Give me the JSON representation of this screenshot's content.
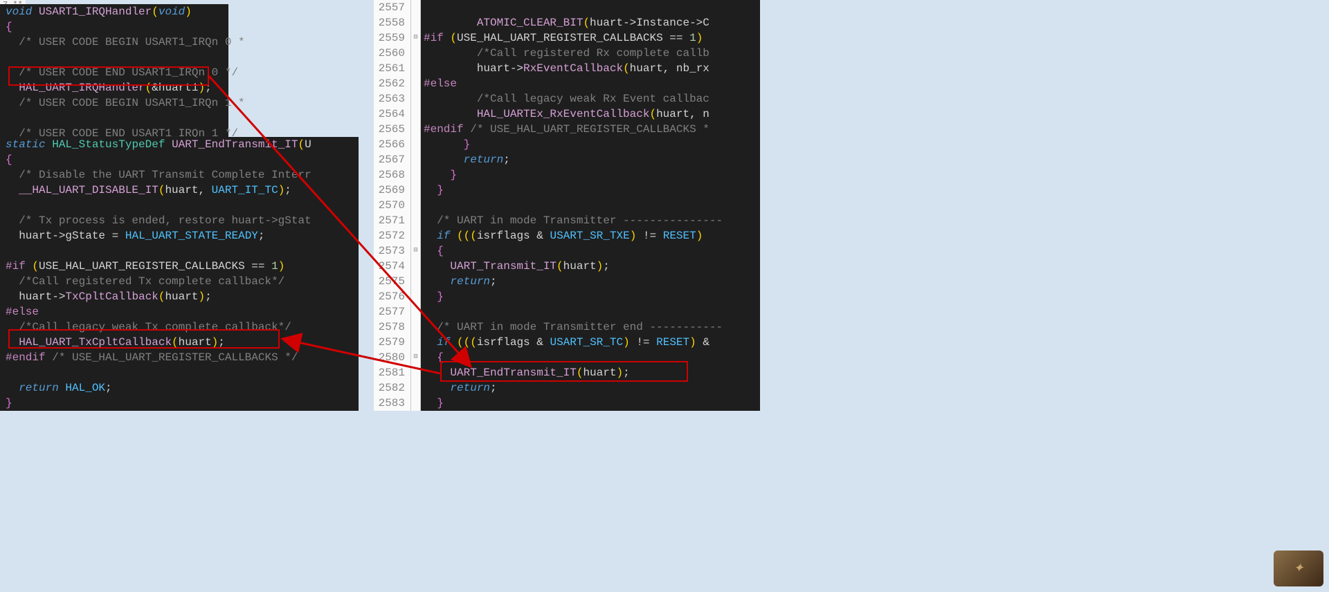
{
  "topleft": "7 **",
  "left_top_lines": [
    {
      "tokens": [
        {
          "c": "kw",
          "t": "void"
        },
        {
          "c": "plain",
          "t": " "
        },
        {
          "c": "fn2",
          "t": "USART1_IRQHandler"
        },
        {
          "c": "paren",
          "t": "("
        },
        {
          "c": "kw",
          "t": "void"
        },
        {
          "c": "paren",
          "t": ")"
        }
      ]
    },
    {
      "tokens": [
        {
          "c": "brace",
          "t": "{"
        }
      ]
    },
    {
      "tokens": [
        {
          "c": "cmt2",
          "t": "  /* USER CODE BEGIN USART1_IRQn 0 *"
        }
      ]
    },
    {
      "tokens": [
        {
          "c": "plain",
          "t": " "
        }
      ]
    },
    {
      "tokens": [
        {
          "c": "cmt2",
          "t": "  /* USER CODE END USART1_IRQn 0 */"
        }
      ]
    },
    {
      "tokens": [
        {
          "c": "plain",
          "t": "  "
        },
        {
          "c": "fn2",
          "t": "HAL_UART_IRQHandler"
        },
        {
          "c": "paren",
          "t": "("
        },
        {
          "c": "op",
          "t": "&"
        },
        {
          "c": "plain",
          "t": "huart1"
        },
        {
          "c": "paren",
          "t": ")"
        },
        {
          "c": "plain",
          "t": ";"
        }
      ]
    },
    {
      "tokens": [
        {
          "c": "cmt2",
          "t": "  /* USER CODE BEGIN USART1_IRQn 1 *"
        }
      ]
    },
    {
      "tokens": [
        {
          "c": "plain",
          "t": " "
        }
      ]
    },
    {
      "tokens": [
        {
          "c": "cmt2",
          "t": "  /* USER CODE END USART1_IRQn 1 */"
        }
      ]
    },
    {
      "tokens": [
        {
          "c": "brace",
          "t": "}"
        }
      ]
    }
  ],
  "left_bottom_lines": [
    {
      "tokens": [
        {
          "c": "kw",
          "t": "static"
        },
        {
          "c": "plain",
          "t": " "
        },
        {
          "c": "type",
          "t": "HAL_StatusTypeDef"
        },
        {
          "c": "plain",
          "t": " "
        },
        {
          "c": "fn2",
          "t": "UART_EndTransmit_IT"
        },
        {
          "c": "paren",
          "t": "("
        },
        {
          "c": "plain",
          "t": "U"
        }
      ]
    },
    {
      "tokens": [
        {
          "c": "brace",
          "t": "{"
        }
      ]
    },
    {
      "tokens": [
        {
          "c": "cmt2",
          "t": "  /* Disable the UART Transmit Complete Interr"
        }
      ]
    },
    {
      "tokens": [
        {
          "c": "plain",
          "t": "  "
        },
        {
          "c": "fn2",
          "t": "__HAL_UART_DISABLE_IT"
        },
        {
          "c": "paren",
          "t": "("
        },
        {
          "c": "plain",
          "t": "huart, "
        },
        {
          "c": "const",
          "t": "UART_IT_TC"
        },
        {
          "c": "paren",
          "t": ")"
        },
        {
          "c": "plain",
          "t": ";"
        }
      ]
    },
    {
      "tokens": [
        {
          "c": "plain",
          "t": " "
        }
      ]
    },
    {
      "tokens": [
        {
          "c": "cmt2",
          "t": "  /* Tx process is ended, restore huart->gStat"
        }
      ]
    },
    {
      "tokens": [
        {
          "c": "plain",
          "t": "  huart"
        },
        {
          "c": "op",
          "t": "->"
        },
        {
          "c": "plain",
          "t": "gState "
        },
        {
          "c": "op",
          "t": "="
        },
        {
          "c": "plain",
          "t": " "
        },
        {
          "c": "const",
          "t": "HAL_UART_STATE_READY"
        },
        {
          "c": "plain",
          "t": ";"
        }
      ]
    },
    {
      "tokens": [
        {
          "c": "plain",
          "t": " "
        }
      ]
    },
    {
      "tokens": [
        {
          "c": "macro",
          "t": "#if"
        },
        {
          "c": "plain",
          "t": " "
        },
        {
          "c": "paren",
          "t": "("
        },
        {
          "c": "plain",
          "t": "USE_HAL_UART_REGISTER_CALLBACKS "
        },
        {
          "c": "op",
          "t": "=="
        },
        {
          "c": "plain",
          "t": " "
        },
        {
          "c": "num",
          "t": "1"
        },
        {
          "c": "paren",
          "t": ")"
        }
      ]
    },
    {
      "tokens": [
        {
          "c": "cmt2",
          "t": "  /*Call registered Tx complete callback*/"
        }
      ]
    },
    {
      "tokens": [
        {
          "c": "plain",
          "t": "  huart"
        },
        {
          "c": "op",
          "t": "->"
        },
        {
          "c": "fn2",
          "t": "TxCpltCallback"
        },
        {
          "c": "paren",
          "t": "("
        },
        {
          "c": "plain",
          "t": "huart"
        },
        {
          "c": "paren",
          "t": ")"
        },
        {
          "c": "plain",
          "t": ";"
        }
      ]
    },
    {
      "tokens": [
        {
          "c": "macro",
          "t": "#else"
        }
      ]
    },
    {
      "tokens": [
        {
          "c": "cmt2",
          "t": "  /*Call legacy weak Tx complete callback*/"
        }
      ]
    },
    {
      "tokens": [
        {
          "c": "plain",
          "t": "  "
        },
        {
          "c": "fn2",
          "t": "HAL_UART_TxCpltCallback"
        },
        {
          "c": "paren",
          "t": "("
        },
        {
          "c": "plain",
          "t": "huart"
        },
        {
          "c": "paren",
          "t": ")"
        },
        {
          "c": "plain",
          "t": ";"
        }
      ]
    },
    {
      "tokens": [
        {
          "c": "macro",
          "t": "#endif"
        },
        {
          "c": "plain",
          "t": " "
        },
        {
          "c": "cmt2",
          "t": "/* USE_HAL_UART_REGISTER_CALLBACKS */"
        }
      ]
    },
    {
      "tokens": [
        {
          "c": "plain",
          "t": " "
        }
      ]
    },
    {
      "tokens": [
        {
          "c": "plain",
          "t": "  "
        },
        {
          "c": "kw",
          "t": "return"
        },
        {
          "c": "plain",
          "t": " "
        },
        {
          "c": "const",
          "t": "HAL_OK"
        },
        {
          "c": "plain",
          "t": ";"
        }
      ]
    },
    {
      "tokens": [
        {
          "c": "brace",
          "t": "}"
        }
      ]
    }
  ],
  "right_lines": [
    {
      "n": "2557",
      "fold": "",
      "tokens": [
        {
          "c": "plain",
          "t": " "
        }
      ]
    },
    {
      "n": "2558",
      "fold": "",
      "tokens": [
        {
          "c": "plain",
          "t": "        "
        },
        {
          "c": "fn2",
          "t": "ATOMIC_CLEAR_BIT"
        },
        {
          "c": "paren",
          "t": "("
        },
        {
          "c": "plain",
          "t": "huart"
        },
        {
          "c": "op",
          "t": "->"
        },
        {
          "c": "plain",
          "t": "Instance"
        },
        {
          "c": "op",
          "t": "->"
        },
        {
          "c": "plain",
          "t": "C"
        }
      ]
    },
    {
      "n": "2559",
      "fold": "⊟",
      "tokens": [
        {
          "c": "macro",
          "t": "#if"
        },
        {
          "c": "plain",
          "t": " "
        },
        {
          "c": "paren",
          "t": "("
        },
        {
          "c": "plain",
          "t": "USE_HAL_UART_REGISTER_CALLBACKS "
        },
        {
          "c": "op",
          "t": "=="
        },
        {
          "c": "plain",
          "t": " "
        },
        {
          "c": "num",
          "t": "1"
        },
        {
          "c": "paren",
          "t": ")"
        }
      ]
    },
    {
      "n": "2560",
      "fold": "",
      "tokens": [
        {
          "c": "cmt2",
          "t": "        /*Call registered Rx complete callb"
        }
      ]
    },
    {
      "n": "2561",
      "fold": "",
      "tokens": [
        {
          "c": "plain",
          "t": "        huart"
        },
        {
          "c": "op",
          "t": "->"
        },
        {
          "c": "fn2",
          "t": "RxEventCallback"
        },
        {
          "c": "paren",
          "t": "("
        },
        {
          "c": "plain",
          "t": "huart, nb_rx"
        }
      ]
    },
    {
      "n": "2562",
      "fold": "",
      "tokens": [
        {
          "c": "macro",
          "t": "#else"
        }
      ]
    },
    {
      "n": "2563",
      "fold": "",
      "tokens": [
        {
          "c": "cmt2",
          "t": "        /*Call legacy weak Rx Event callbac"
        }
      ]
    },
    {
      "n": "2564",
      "fold": "",
      "tokens": [
        {
          "c": "plain",
          "t": "        "
        },
        {
          "c": "fn2",
          "t": "HAL_UARTEx_RxEventCallback"
        },
        {
          "c": "paren",
          "t": "("
        },
        {
          "c": "plain",
          "t": "huart, n"
        }
      ]
    },
    {
      "n": "2565",
      "fold": "",
      "tokens": [
        {
          "c": "macro",
          "t": "#endif"
        },
        {
          "c": "plain",
          "t": " "
        },
        {
          "c": "cmt2",
          "t": "/* USE_HAL_UART_REGISTER_CALLBACKS *"
        }
      ]
    },
    {
      "n": "2566",
      "fold": "",
      "tokens": [
        {
          "c": "plain",
          "t": "      "
        },
        {
          "c": "brace",
          "t": "}"
        }
      ]
    },
    {
      "n": "2567",
      "fold": "",
      "tokens": [
        {
          "c": "plain",
          "t": "      "
        },
        {
          "c": "kw",
          "t": "return"
        },
        {
          "c": "plain",
          "t": ";"
        }
      ]
    },
    {
      "n": "2568",
      "fold": "",
      "tokens": [
        {
          "c": "plain",
          "t": "    "
        },
        {
          "c": "brace",
          "t": "}"
        }
      ]
    },
    {
      "n": "2569",
      "fold": "",
      "tokens": [
        {
          "c": "plain",
          "t": "  "
        },
        {
          "c": "brace",
          "t": "}"
        }
      ]
    },
    {
      "n": "2570",
      "fold": "",
      "tokens": [
        {
          "c": "plain",
          "t": " "
        }
      ]
    },
    {
      "n": "2571",
      "fold": "",
      "tokens": [
        {
          "c": "cmt2",
          "t": "  /* UART in mode Transmitter ---------------"
        }
      ]
    },
    {
      "n": "2572",
      "fold": "",
      "tokens": [
        {
          "c": "plain",
          "t": "  "
        },
        {
          "c": "kw",
          "t": "if"
        },
        {
          "c": "plain",
          "t": " "
        },
        {
          "c": "paren",
          "t": "((("
        },
        {
          "c": "plain",
          "t": "isrflags "
        },
        {
          "c": "op",
          "t": "&"
        },
        {
          "c": "plain",
          "t": " "
        },
        {
          "c": "const",
          "t": "USART_SR_TXE"
        },
        {
          "c": "paren",
          "t": ")"
        },
        {
          "c": "plain",
          "t": " "
        },
        {
          "c": "op",
          "t": "!="
        },
        {
          "c": "plain",
          "t": " "
        },
        {
          "c": "const",
          "t": "RESET"
        },
        {
          "c": "paren",
          "t": ")"
        }
      ]
    },
    {
      "n": "2573",
      "fold": "⊟",
      "tokens": [
        {
          "c": "plain",
          "t": "  "
        },
        {
          "c": "brace",
          "t": "{"
        }
      ]
    },
    {
      "n": "2574",
      "fold": "",
      "tokens": [
        {
          "c": "plain",
          "t": "    "
        },
        {
          "c": "fn2",
          "t": "UART_Transmit_IT"
        },
        {
          "c": "paren",
          "t": "("
        },
        {
          "c": "plain",
          "t": "huart"
        },
        {
          "c": "paren",
          "t": ")"
        },
        {
          "c": "plain",
          "t": ";"
        }
      ]
    },
    {
      "n": "2575",
      "fold": "",
      "tokens": [
        {
          "c": "plain",
          "t": "    "
        },
        {
          "c": "kw",
          "t": "return"
        },
        {
          "c": "plain",
          "t": ";"
        }
      ]
    },
    {
      "n": "2576",
      "fold": "",
      "tokens": [
        {
          "c": "plain",
          "t": "  "
        },
        {
          "c": "brace",
          "t": "}"
        }
      ]
    },
    {
      "n": "2577",
      "fold": "",
      "tokens": [
        {
          "c": "plain",
          "t": " "
        }
      ]
    },
    {
      "n": "2578",
      "fold": "",
      "tokens": [
        {
          "c": "cmt2",
          "t": "  /* UART in mode Transmitter end -----------"
        }
      ]
    },
    {
      "n": "2579",
      "fold": "",
      "tokens": [
        {
          "c": "plain",
          "t": "  "
        },
        {
          "c": "kw",
          "t": "if"
        },
        {
          "c": "plain",
          "t": " "
        },
        {
          "c": "paren",
          "t": "((("
        },
        {
          "c": "plain",
          "t": "isrflags "
        },
        {
          "c": "op",
          "t": "&"
        },
        {
          "c": "plain",
          "t": " "
        },
        {
          "c": "const",
          "t": "USART_SR_TC"
        },
        {
          "c": "paren",
          "t": ")"
        },
        {
          "c": "plain",
          "t": " "
        },
        {
          "c": "op",
          "t": "!="
        },
        {
          "c": "plain",
          "t": " "
        },
        {
          "c": "const",
          "t": "RESET"
        },
        {
          "c": "paren",
          "t": ")"
        },
        {
          "c": "plain",
          "t": " "
        },
        {
          "c": "op",
          "t": "&"
        }
      ]
    },
    {
      "n": "2580",
      "fold": "⊟",
      "tokens": [
        {
          "c": "plain",
          "t": "  "
        },
        {
          "c": "brace",
          "t": "{"
        }
      ]
    },
    {
      "n": "2581",
      "fold": "",
      "tokens": [
        {
          "c": "plain",
          "t": "    "
        },
        {
          "c": "fn2",
          "t": "UART_EndTransmit_IT"
        },
        {
          "c": "paren",
          "t": "("
        },
        {
          "c": "plain",
          "t": "huart"
        },
        {
          "c": "paren",
          "t": ")"
        },
        {
          "c": "plain",
          "t": ";"
        }
      ]
    },
    {
      "n": "2582",
      "fold": "",
      "tokens": [
        {
          "c": "plain",
          "t": "    "
        },
        {
          "c": "kw",
          "t": "return"
        },
        {
          "c": "plain",
          "t": ";"
        }
      ]
    },
    {
      "n": "2583",
      "fold": "",
      "tokens": [
        {
          "c": "plain",
          "t": "  "
        },
        {
          "c": "brace",
          "t": "}"
        }
      ]
    }
  ]
}
